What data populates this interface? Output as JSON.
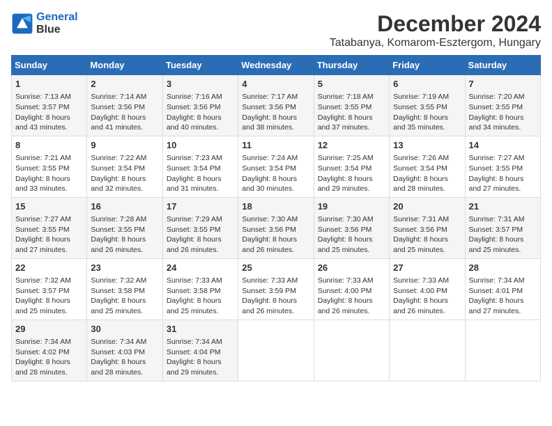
{
  "logo": {
    "line1": "General",
    "line2": "Blue"
  },
  "title": "December 2024",
  "location": "Tatabanya, Komarom-Esztergom, Hungary",
  "days_of_week": [
    "Sunday",
    "Monday",
    "Tuesday",
    "Wednesday",
    "Thursday",
    "Friday",
    "Saturday"
  ],
  "weeks": [
    [
      {
        "day": 1,
        "sunrise": "7:13 AM",
        "sunset": "3:57 PM",
        "daylight": "8 hours and 43 minutes."
      },
      {
        "day": 2,
        "sunrise": "7:14 AM",
        "sunset": "3:56 PM",
        "daylight": "8 hours and 41 minutes."
      },
      {
        "day": 3,
        "sunrise": "7:16 AM",
        "sunset": "3:56 PM",
        "daylight": "8 hours and 40 minutes."
      },
      {
        "day": 4,
        "sunrise": "7:17 AM",
        "sunset": "3:56 PM",
        "daylight": "8 hours and 38 minutes."
      },
      {
        "day": 5,
        "sunrise": "7:18 AM",
        "sunset": "3:55 PM",
        "daylight": "8 hours and 37 minutes."
      },
      {
        "day": 6,
        "sunrise": "7:19 AM",
        "sunset": "3:55 PM",
        "daylight": "8 hours and 35 minutes."
      },
      {
        "day": 7,
        "sunrise": "7:20 AM",
        "sunset": "3:55 PM",
        "daylight": "8 hours and 34 minutes."
      }
    ],
    [
      {
        "day": 8,
        "sunrise": "7:21 AM",
        "sunset": "3:55 PM",
        "daylight": "8 hours and 33 minutes."
      },
      {
        "day": 9,
        "sunrise": "7:22 AM",
        "sunset": "3:54 PM",
        "daylight": "8 hours and 32 minutes."
      },
      {
        "day": 10,
        "sunrise": "7:23 AM",
        "sunset": "3:54 PM",
        "daylight": "8 hours and 31 minutes."
      },
      {
        "day": 11,
        "sunrise": "7:24 AM",
        "sunset": "3:54 PM",
        "daylight": "8 hours and 30 minutes."
      },
      {
        "day": 12,
        "sunrise": "7:25 AM",
        "sunset": "3:54 PM",
        "daylight": "8 hours and 29 minutes."
      },
      {
        "day": 13,
        "sunrise": "7:26 AM",
        "sunset": "3:54 PM",
        "daylight": "8 hours and 28 minutes."
      },
      {
        "day": 14,
        "sunrise": "7:27 AM",
        "sunset": "3:55 PM",
        "daylight": "8 hours and 27 minutes."
      }
    ],
    [
      {
        "day": 15,
        "sunrise": "7:27 AM",
        "sunset": "3:55 PM",
        "daylight": "8 hours and 27 minutes."
      },
      {
        "day": 16,
        "sunrise": "7:28 AM",
        "sunset": "3:55 PM",
        "daylight": "8 hours and 26 minutes."
      },
      {
        "day": 17,
        "sunrise": "7:29 AM",
        "sunset": "3:55 PM",
        "daylight": "8 hours and 26 minutes."
      },
      {
        "day": 18,
        "sunrise": "7:30 AM",
        "sunset": "3:56 PM",
        "daylight": "8 hours and 26 minutes."
      },
      {
        "day": 19,
        "sunrise": "7:30 AM",
        "sunset": "3:56 PM",
        "daylight": "8 hours and 25 minutes."
      },
      {
        "day": 20,
        "sunrise": "7:31 AM",
        "sunset": "3:56 PM",
        "daylight": "8 hours and 25 minutes."
      },
      {
        "day": 21,
        "sunrise": "7:31 AM",
        "sunset": "3:57 PM",
        "daylight": "8 hours and 25 minutes."
      }
    ],
    [
      {
        "day": 22,
        "sunrise": "7:32 AM",
        "sunset": "3:57 PM",
        "daylight": "8 hours and 25 minutes."
      },
      {
        "day": 23,
        "sunrise": "7:32 AM",
        "sunset": "3:58 PM",
        "daylight": "8 hours and 25 minutes."
      },
      {
        "day": 24,
        "sunrise": "7:33 AM",
        "sunset": "3:58 PM",
        "daylight": "8 hours and 25 minutes."
      },
      {
        "day": 25,
        "sunrise": "7:33 AM",
        "sunset": "3:59 PM",
        "daylight": "8 hours and 26 minutes."
      },
      {
        "day": 26,
        "sunrise": "7:33 AM",
        "sunset": "4:00 PM",
        "daylight": "8 hours and 26 minutes."
      },
      {
        "day": 27,
        "sunrise": "7:33 AM",
        "sunset": "4:00 PM",
        "daylight": "8 hours and 26 minutes."
      },
      {
        "day": 28,
        "sunrise": "7:34 AM",
        "sunset": "4:01 PM",
        "daylight": "8 hours and 27 minutes."
      }
    ],
    [
      {
        "day": 29,
        "sunrise": "7:34 AM",
        "sunset": "4:02 PM",
        "daylight": "8 hours and 28 minutes."
      },
      {
        "day": 30,
        "sunrise": "7:34 AM",
        "sunset": "4:03 PM",
        "daylight": "8 hours and 28 minutes."
      },
      {
        "day": 31,
        "sunrise": "7:34 AM",
        "sunset": "4:04 PM",
        "daylight": "8 hours and 29 minutes."
      },
      null,
      null,
      null,
      null
    ]
  ]
}
